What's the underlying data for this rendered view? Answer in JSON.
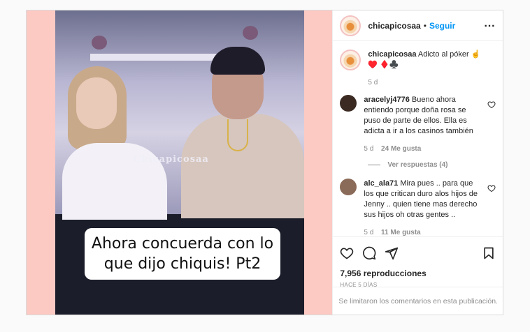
{
  "video": {
    "watermark": "Chicapicosaa",
    "caption_line1": "Ahora concuerda con lo",
    "caption_line2": "que dijo chiquis! Pt2"
  },
  "header": {
    "username": "chicapicosaa",
    "separator": "•",
    "follow_label": "Seguir",
    "more_icon": "⋯"
  },
  "caption": {
    "username": "chicapicosaa",
    "text": "Adicto al póker ☝️♥️ ♦️♣️",
    "time": "5 d"
  },
  "comments": [
    {
      "username": "aracelyj4776",
      "text": "Bueno ahora entiendo porque doña rosa se puso de parte de ellos. Ella es adicta a ir a los casinos también",
      "time": "5 d",
      "likes": "24 Me gusta",
      "avatar_color": "#3a2a22"
    },
    {
      "username": "alc_ala71",
      "text": "Mira pues .. para que los que critican duro alos hijos de Jenny .. quien tiene mas derecho sus hijos oh otras gentes ..",
      "time": "5 d",
      "likes": "11 Me gusta",
      "avatar_color": "#8a6a58"
    }
  ],
  "view_replies": "Ver respuestas (4)",
  "views": "7,956 reproducciones",
  "posted_ago": "HACE 5 DÍAS",
  "comments_limited": "Se limitaron los comentarios en esta publicación.",
  "colors": {
    "accent": "#0095f6",
    "media_bg": "#fcc9c3"
  }
}
